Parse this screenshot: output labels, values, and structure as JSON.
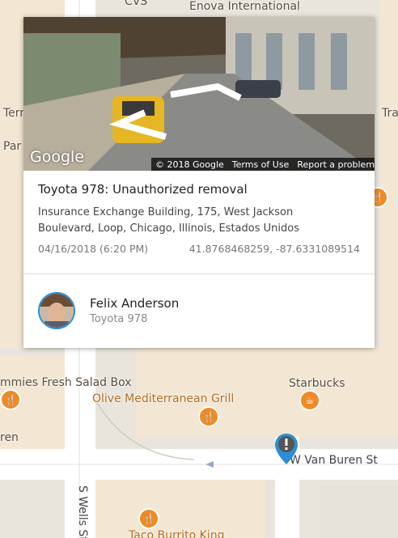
{
  "map": {
    "labels": {
      "cvs": "CVS",
      "enova": "Enova International",
      "term": "Term",
      "par": "Par",
      "tra": "Tra",
      "salad": "mmies Fresh Salad Box",
      "olive": "Olive Mediterranean Grill",
      "starbucks": "Starbucks",
      "ren": "ren",
      "van_buren": "W Van Buren St",
      "wells": "S Wells St",
      "taco": "Taco Burrito King"
    },
    "colors": {
      "background": "#e9e5dc",
      "building": "#f3e7d3",
      "road": "#ffffff",
      "poi": "#f08a24",
      "marker": "#2a8fd6"
    },
    "icons": {
      "restaurant": "fork-knife-icon",
      "cafe": "coffee-cup-icon",
      "alert": "exclamation-icon"
    }
  },
  "card": {
    "street_view": {
      "logo": "Google",
      "copyright": "© 2018 Google",
      "terms": "Terms of Use",
      "report": "Report a problem"
    },
    "event": {
      "title": "Toyota 978: Unauthorized removal",
      "address": "Insurance Exchange Building, 175, West Jackson Boulevard, Loop, Chicago, Illinois, Estados Unidos",
      "datetime": "04/16/2018 (6:20 PM)",
      "coordinates": "41.8768468259, -87.6331089514"
    },
    "driver": {
      "name": "Felix Anderson",
      "vehicle": "Toyota 978"
    }
  }
}
